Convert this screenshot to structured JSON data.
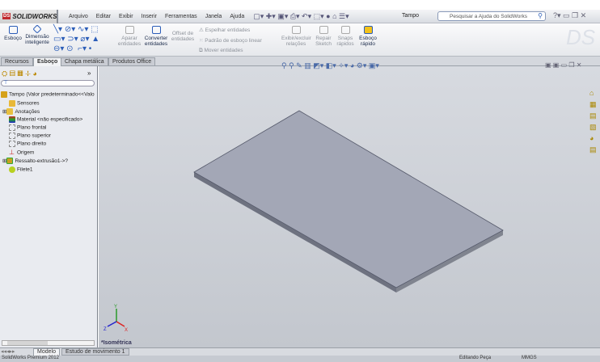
{
  "app": {
    "logo": "SOLIDWORKS",
    "document_title": "Tampo",
    "search_placeholder": "Pesquisar a Ajuda do SolidWorks"
  },
  "menu": [
    "Arquivo",
    "Editar",
    "Exibir",
    "Inserir",
    "Ferramentas",
    "Janela",
    "Ajuda"
  ],
  "ribbon": {
    "esboco": "Esboço",
    "dimensao": "Dimensão inteligente",
    "aparar": "Aparar entidades",
    "converter": "Converter entidades",
    "offset": "Offset de entidades",
    "espelhar": "Espelhar entidades",
    "padrao": "Padrão de esboço linear",
    "mover": "Mover entidades",
    "exibir": "Exibir/excluir relações",
    "repair": "Repair Sketch",
    "snaps": "Snaps rápidos",
    "rapido": "Esboço rápido"
  },
  "tabs": [
    "Recursos",
    "Esboço",
    "Chapa metálica",
    "Produtos Office"
  ],
  "active_tab": "Esboço",
  "tree": {
    "root": "Tampo  (Valor predeterminado<<Valo",
    "items": [
      "Sensores",
      "Anotações",
      "Material <não especificado>",
      "Plano frontal",
      "Plano superior",
      "Plano direito",
      "Origem",
      "Ressalto-extrusão1->?",
      "Filete1"
    ]
  },
  "view": {
    "orientation": "*Isométrica",
    "axes": {
      "x": "X",
      "y": "Y",
      "z": "Z"
    }
  },
  "bottom_tabs": [
    "Modelo",
    "Estudo de movimento 1"
  ],
  "status": {
    "product": "SolidWorks Premium 2012",
    "mode": "Editando Peça",
    "units": "MMGS"
  },
  "colors": {
    "plate_top": "#a3a7b6",
    "plate_side": "#6e7280",
    "accent": "#2b5db8"
  }
}
